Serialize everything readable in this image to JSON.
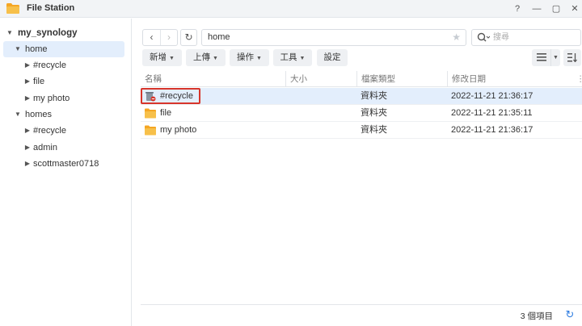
{
  "window": {
    "title": "File Station",
    "controls": {
      "help": "?",
      "minimize": "—",
      "maximize": "▢",
      "close": "✕"
    }
  },
  "sidebar": {
    "root": "my_synology",
    "items": [
      {
        "label": "home",
        "level": 1,
        "expanded": true,
        "selected": true
      },
      {
        "label": "#recycle",
        "level": 2
      },
      {
        "label": "file",
        "level": 2
      },
      {
        "label": "my photo",
        "level": 2
      },
      {
        "label": "homes",
        "level": 1,
        "expanded": true
      },
      {
        "label": "#recycle",
        "level": 2
      },
      {
        "label": "admin",
        "level": 2
      },
      {
        "label": "scottmaster0718",
        "level": 2
      }
    ]
  },
  "toolbar": {
    "path": "home",
    "search_placeholder": "搜尋",
    "buttons": {
      "new": "新增",
      "upload": "上傳",
      "action": "操作",
      "tools": "工具",
      "settings": "設定"
    }
  },
  "table": {
    "columns": {
      "name": "名稱",
      "size": "大小",
      "type": "檔案類型",
      "modified": "修改日期"
    },
    "rows": [
      {
        "name": "#recycle",
        "size": "",
        "type": "資料夾",
        "modified": "2022-11-21 21:36:17",
        "icon": "recycle-bin-icon",
        "selected": true
      },
      {
        "name": "file",
        "size": "",
        "type": "資料夾",
        "modified": "2022-11-21 21:35:11",
        "icon": "folder-icon"
      },
      {
        "name": "my photo",
        "size": "",
        "type": "資料夾",
        "modified": "2022-11-21 21:36:17",
        "icon": "folder-icon"
      }
    ]
  },
  "footer": {
    "item_count": "3 個項目"
  },
  "colors": {
    "selection": "#e3eefc",
    "folder": "#f7b731",
    "highlight": "#d7352b",
    "accent": "#2f7de1"
  }
}
